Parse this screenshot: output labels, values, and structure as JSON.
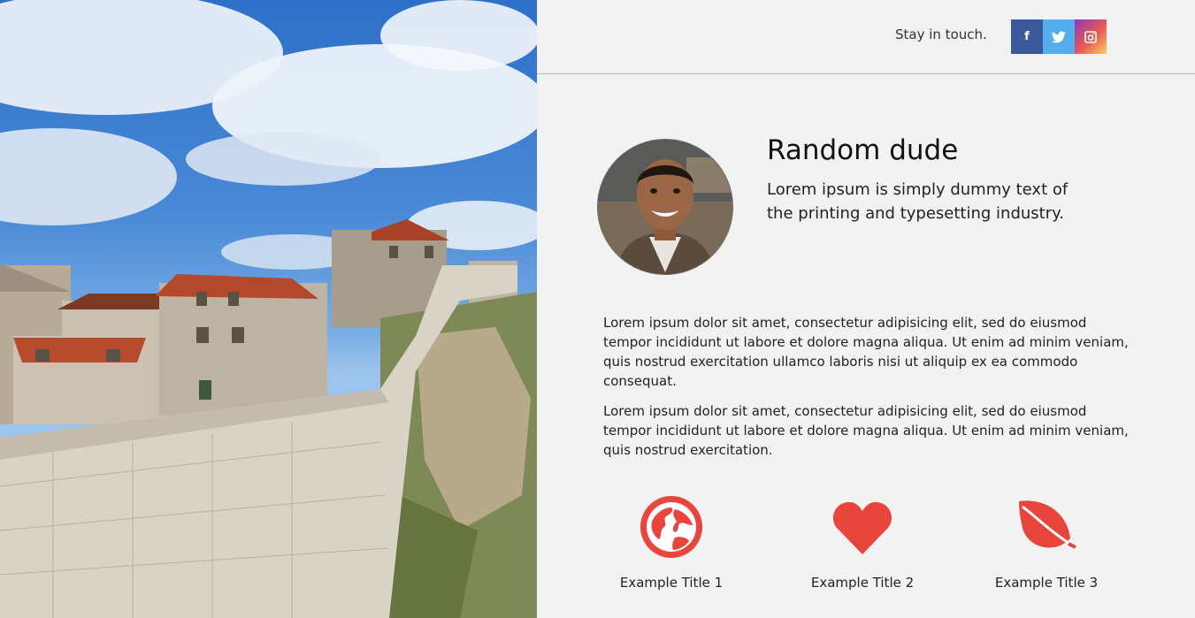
{
  "header": {
    "stay_label": "Stay in touch.",
    "social": [
      {
        "name": "facebook",
        "glyph": "f",
        "color": "#3b5998"
      },
      {
        "name": "twitter",
        "glyph": "twitter-bird",
        "color": "#55acee"
      },
      {
        "name": "instagram",
        "glyph": "instagram-camera",
        "color": "#e95950"
      }
    ]
  },
  "profile": {
    "name": "Random dude",
    "tagline": "Lorem ipsum is simply dummy text of the printing and typesetting industry."
  },
  "body": {
    "paragraphs": [
      "Lorem ipsum dolor sit amet, consectetur adipisicing elit, sed do eiusmod tempor incididunt ut labore et dolore magna aliqua. Ut enim ad minim veniam, quis nostrud exercitation ullamco laboris nisi ut aliquip ex ea commodo consequat.",
      "Lorem ipsum dolor sit amet, consectetur adipisicing elit, sed do eiusmod tempor incididunt ut labore et dolore magna aliqua. Ut enim ad minim veniam, quis nostrud exercitation."
    ]
  },
  "features": [
    {
      "title": "Example Title 1",
      "icon": "globe-icon"
    },
    {
      "title": "Example Title 2",
      "icon": "heart-icon"
    },
    {
      "title": "Example Title 3",
      "icon": "leaf-icon"
    }
  ],
  "colors": {
    "accent": "#e8453c",
    "background": "#f2f2f2",
    "divider": "#b8b8b8"
  }
}
